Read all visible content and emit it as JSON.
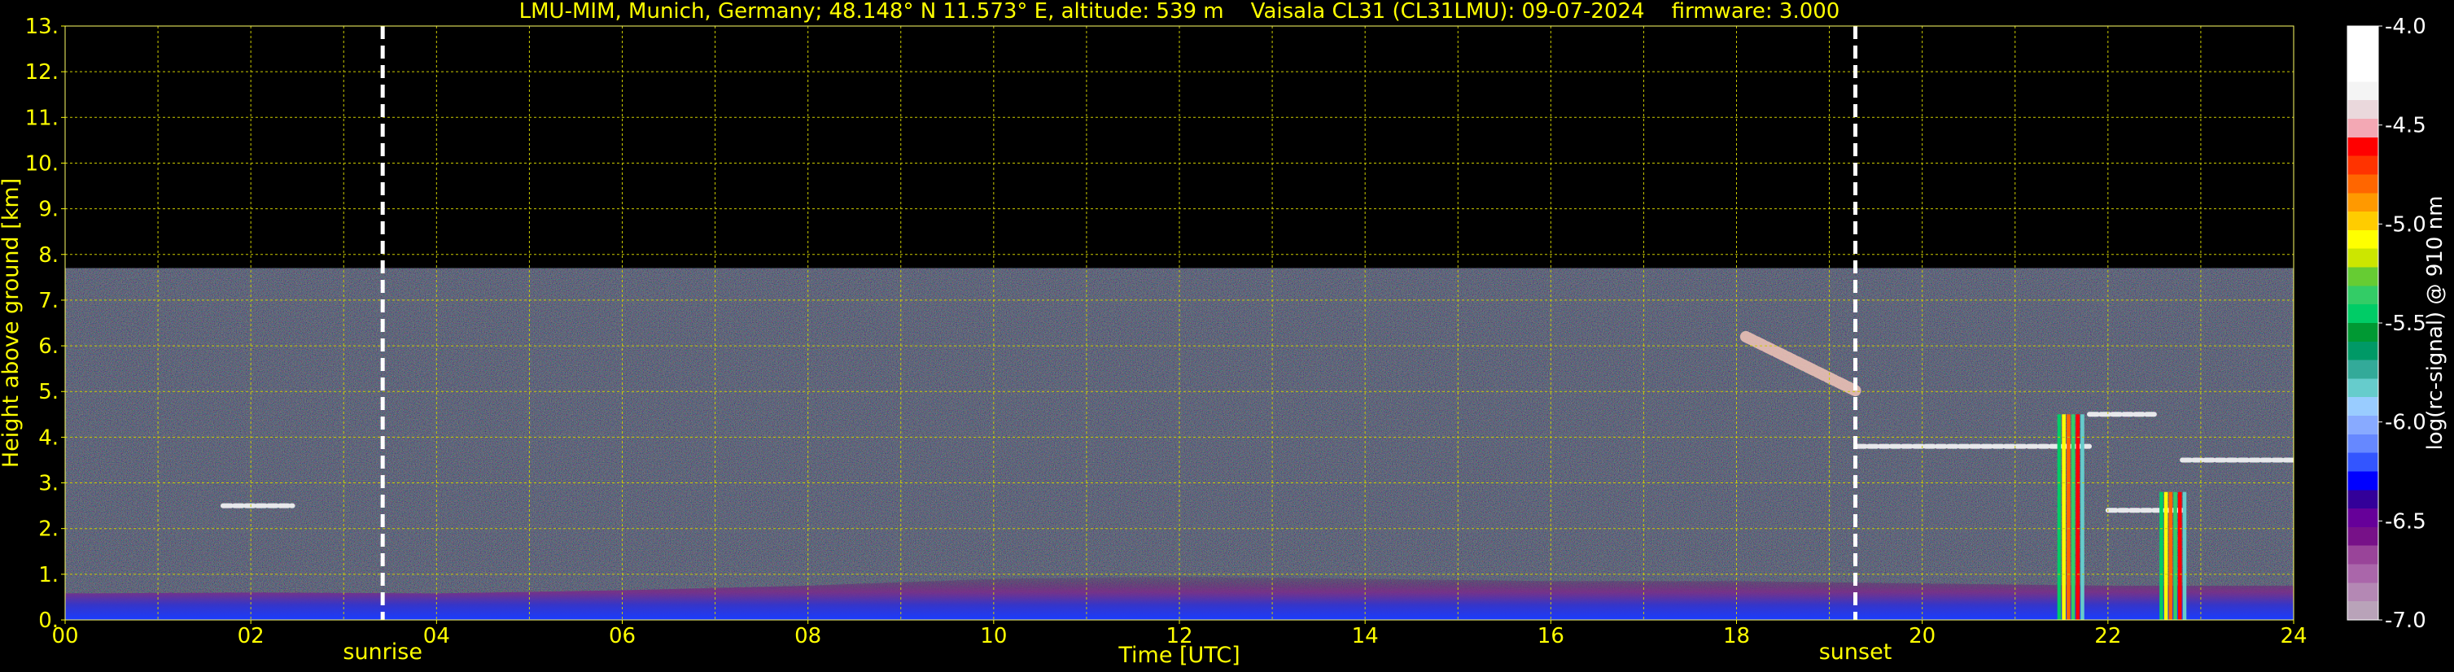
{
  "chart_data": {
    "type": "heatmap",
    "title": "LMU-MIM, Munich, Germany; 48.148° N 11.573° E, altitude: 539 m    Vaisala CL31 (CL31LMU): 09-07-2024    firmware: 3.000",
    "xlabel": "Time [UTC]",
    "ylabel": "Height above ground [km]",
    "xlim": [
      0,
      24
    ],
    "ylim": [
      0,
      13
    ],
    "x_ticks": [
      "00",
      "02",
      "04",
      "06",
      "08",
      "10",
      "12",
      "14",
      "16",
      "18",
      "20",
      "22",
      "24"
    ],
    "y_ticks": [
      "0.",
      "1.",
      "2.",
      "3.",
      "4.",
      "5.",
      "6.",
      "7.",
      "8.",
      "9.",
      "10.",
      "11.",
      "12.",
      "13."
    ],
    "grid": true,
    "data_top_km": 7.7,
    "markers": [
      {
        "label": "sunrise",
        "x": 3.42
      },
      {
        "label": "sunset",
        "x": 19.28
      }
    ],
    "colorbar": {
      "label": "log(rc-signal) @ 910 nm",
      "range": [
        -7.0,
        -4.0
      ],
      "ticks": [
        "-4.0",
        "-4.5",
        "-5.0",
        "-5.5",
        "-6.0",
        "-6.5",
        "-7.0"
      ],
      "colors": [
        "#ffffff",
        "#ffffff",
        "#ffffff",
        "#f4f4f4",
        "#ead8dc",
        "#f3a8b4",
        "#ff0000",
        "#ff3300",
        "#ff6600",
        "#ff9900",
        "#ffcc00",
        "#ffff00",
        "#cce600",
        "#66cc33",
        "#33cc66",
        "#00cc66",
        "#009933",
        "#009966",
        "#33aa99",
        "#66cccc",
        "#99ccff",
        "#88aaff",
        "#6688ff",
        "#3355ff",
        "#0000ff",
        "#330099",
        "#660099",
        "#771188",
        "#994499",
        "#aa66aa",
        "#b488b4",
        "#b9a3b9"
      ]
    },
    "features": {
      "boundary_layer": [
        {
          "t": 0,
          "top": 0.58
        },
        {
          "t": 2,
          "top": 0.6
        },
        {
          "t": 4,
          "top": 0.58
        },
        {
          "t": 6,
          "top": 0.65
        },
        {
          "t": 8,
          "top": 0.75
        },
        {
          "t": 10,
          "top": 0.9
        },
        {
          "t": 12,
          "top": 0.95
        },
        {
          "t": 14,
          "top": 0.9
        },
        {
          "t": 16,
          "top": 0.85
        },
        {
          "t": 18,
          "top": 0.85
        },
        {
          "t": 20,
          "top": 0.8
        },
        {
          "t": 22,
          "top": 0.75
        },
        {
          "t": 24,
          "top": 0.75
        }
      ],
      "cloud_layers": [
        {
          "t_start": 1.7,
          "t_end": 2.45,
          "height": 2.5
        },
        {
          "t_start": 18.1,
          "t_end": 19.3,
          "height": 6.2,
          "descending_to": 5.0
        },
        {
          "t_start": 19.3,
          "t_end": 21.8,
          "height": 3.8
        },
        {
          "t_start": 21.8,
          "t_end": 22.5,
          "height": 4.5
        },
        {
          "t_start": 22.0,
          "t_end": 22.8,
          "height": 2.4
        },
        {
          "t_start": 22.8,
          "t_end": 24.0,
          "height": 3.5
        }
      ],
      "precipitation": [
        {
          "t_start": 21.45,
          "t_end": 21.75,
          "top": 4.5
        },
        {
          "t_start": 22.55,
          "t_end": 22.85,
          "top": 2.8
        }
      ]
    }
  }
}
